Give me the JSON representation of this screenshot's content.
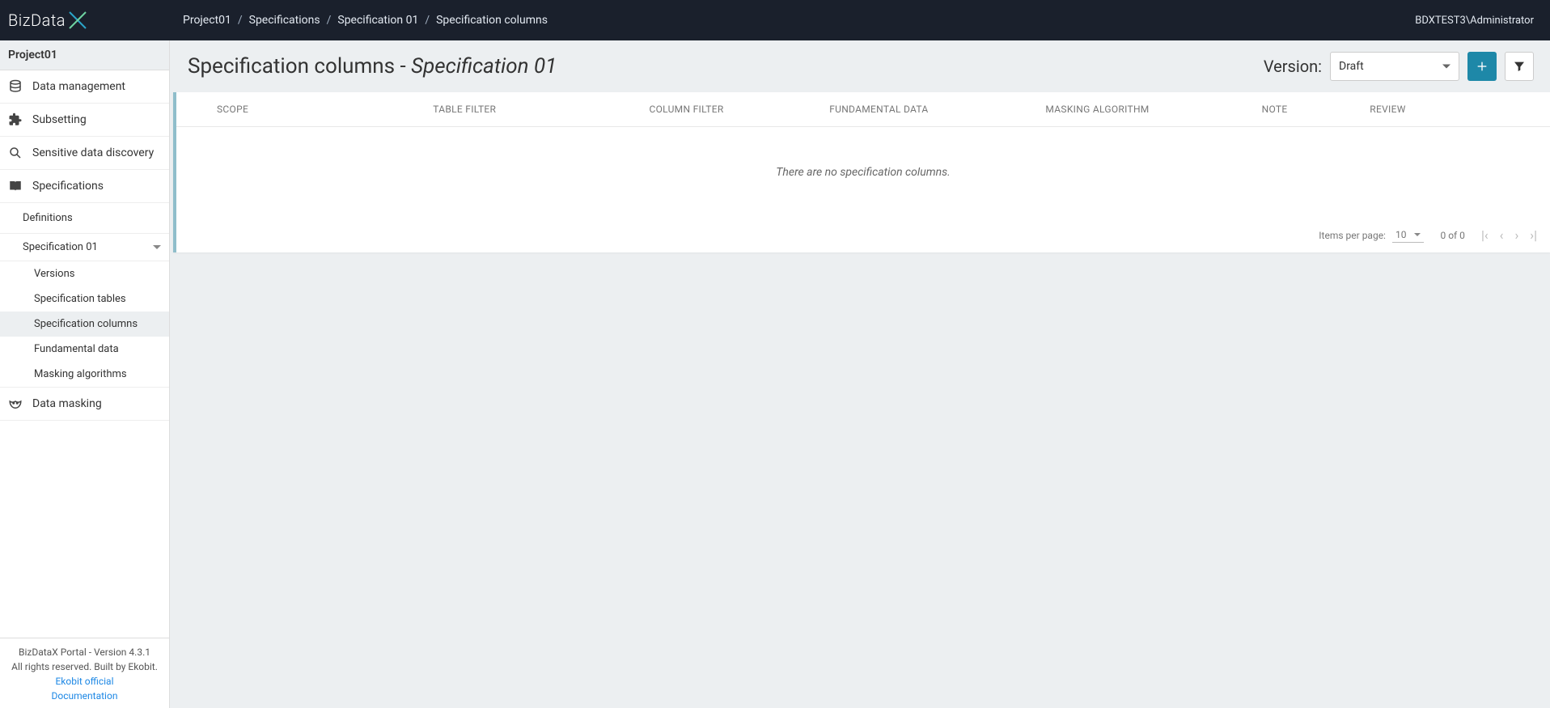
{
  "brand": {
    "name": "BizData"
  },
  "breadcrumb": {
    "items": [
      "Project01",
      "Specifications",
      "Specification 01",
      "Specification columns"
    ]
  },
  "user": "BDXTEST3\\Administrator",
  "sidebar": {
    "project": "Project01",
    "items": {
      "data_management": "Data management",
      "subsetting": "Subsetting",
      "sensitive": "Sensitive data discovery",
      "specifications": "Specifications",
      "definitions": "Definitions",
      "spec01": "Specification 01",
      "versions": "Versions",
      "spec_tables": "Specification tables",
      "spec_columns": "Specification columns",
      "fundamental": "Fundamental data",
      "masking_alg": "Masking algorithms",
      "data_masking": "Data masking"
    },
    "footer": {
      "line1": "BizDataX Portal - Version 4.3.1",
      "line2": "All rights reserved. Built by Ekobit.",
      "link1": "Ekobit official",
      "link2": "Documentation"
    }
  },
  "page": {
    "title_prefix": "Specification columns - ",
    "title_em": "Specification 01",
    "version_label": "Version:",
    "version_value": "Draft"
  },
  "table": {
    "headers": {
      "scope": "SCOPE",
      "table_filter": "TABLE FILTER",
      "column_filter": "COLUMN FILTER",
      "fundamental": "FUNDAMENTAL DATA",
      "masking": "MASKING ALGORITHM",
      "note": "NOTE",
      "review": "REVIEW"
    },
    "empty": "There are no specification columns."
  },
  "paginator": {
    "ipp_label": "Items per page:",
    "ipp_value": "10",
    "range": "0 of 0"
  }
}
